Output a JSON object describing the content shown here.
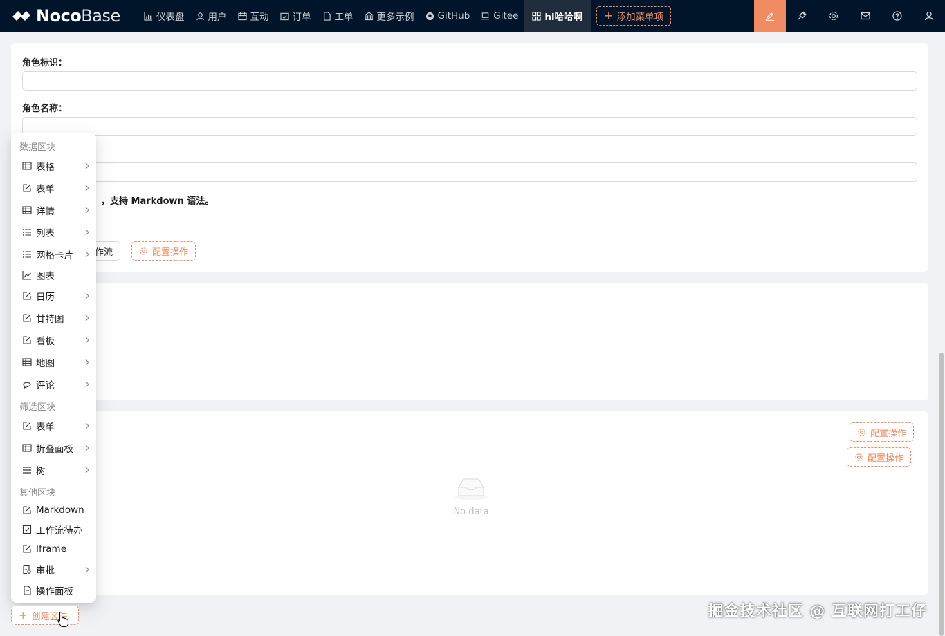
{
  "app": {
    "logo_bold": "Noco",
    "logo_light": "Base"
  },
  "nav": {
    "items": [
      {
        "label": "仪表盘",
        "icon": "bar-chart-icon"
      },
      {
        "label": "用户",
        "icon": "user-icon"
      },
      {
        "label": "互动",
        "icon": "calendar-icon"
      },
      {
        "label": "订单",
        "icon": "check-calendar-icon"
      },
      {
        "label": "工单",
        "icon": "file-icon"
      },
      {
        "label": "更多示例",
        "icon": "bank-icon"
      },
      {
        "label": "GitHub",
        "icon": "github-icon"
      },
      {
        "label": "Gitee",
        "icon": "laptop-icon"
      },
      {
        "label": "hi哈哈啊",
        "icon": "appstore-icon",
        "active": true
      }
    ],
    "add_menu_label": "添加菜单项"
  },
  "toolbar": {
    "tools": [
      "highlight-icon",
      "plugin-icon",
      "setting-icon",
      "mail-icon",
      "help-icon",
      "user-icon"
    ]
  },
  "form": {
    "role_id_label": "角色标识：",
    "role_id_value": "",
    "role_name_label": "角色名称：",
    "role_name_value": "",
    "third_value": "",
    "desc_fragment": "，支持 Markdown 语法。",
    "workflow_btn_partial": "作流",
    "config_action": "配置操作"
  },
  "table_block": {
    "config_action_1": "配置操作",
    "config_action_2": "配置操作",
    "empty_text": "No data"
  },
  "dropdown": {
    "groups": [
      {
        "title": "数据区块",
        "items": [
          {
            "label": "表格",
            "icon": "table-icon",
            "sub": true
          },
          {
            "label": "表单",
            "icon": "edit-icon",
            "sub": true
          },
          {
            "label": "详情",
            "icon": "table-icon",
            "sub": true
          },
          {
            "label": "列表",
            "icon": "list-icon",
            "sub": true
          },
          {
            "label": "网格卡片",
            "icon": "list-icon",
            "sub": true
          },
          {
            "label": "图表",
            "icon": "line-chart-icon",
            "sub": false
          },
          {
            "label": "日历",
            "icon": "edit-icon",
            "sub": true
          },
          {
            "label": "甘特图",
            "icon": "edit-icon",
            "sub": true
          },
          {
            "label": "看板",
            "icon": "edit-icon",
            "sub": true
          },
          {
            "label": "地图",
            "icon": "table-icon",
            "sub": true
          },
          {
            "label": "评论",
            "icon": "comment-icon",
            "sub": true
          }
        ]
      },
      {
        "title": "筛选区块",
        "items": [
          {
            "label": "表单",
            "icon": "edit-icon",
            "sub": true
          },
          {
            "label": "折叠面板",
            "icon": "table-icon",
            "sub": true
          },
          {
            "label": "树",
            "icon": "menu-icon",
            "sub": true
          }
        ]
      },
      {
        "title": "其他区块",
        "items": [
          {
            "label": "Markdown",
            "icon": "edit-icon",
            "sub": false
          },
          {
            "label": "工作流待办",
            "icon": "check-square-icon",
            "sub": false
          },
          {
            "label": "Iframe",
            "icon": "edit-icon",
            "sub": false
          },
          {
            "label": "审批",
            "icon": "audit-icon",
            "sub": true
          },
          {
            "label": "操作面板",
            "icon": "file-icon",
            "sub": false
          }
        ]
      }
    ]
  },
  "create_block_label": "创建区块",
  "watermark": "掘金技术社区 @ 互联网打工仔",
  "colors": {
    "accent": "#f18b62",
    "header": "#001529"
  }
}
